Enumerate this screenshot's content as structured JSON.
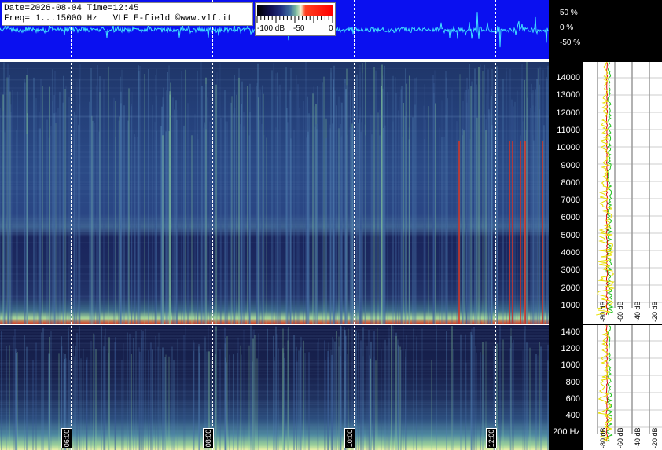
{
  "info": {
    "line1": "Date=2026-08-04 Time=12:45",
    "line2": "Freq= 1...15000 Hz   VLF E-field ©www.vlf.it"
  },
  "colorbar": {
    "labels": [
      "-100 dB",
      "-50",
      "0"
    ]
  },
  "wave_scale": {
    "labels": [
      "50 %",
      "0 %",
      "-50 %"
    ]
  },
  "freq_scale_hi": {
    "labels": [
      "14000",
      "13000",
      "12000",
      "11000",
      "10000",
      "9000",
      "8000",
      "7000",
      "6000",
      "5000",
      "4000",
      "3000",
      "2000",
      "1000"
    ]
  },
  "freq_scale_lo": {
    "labels": [
      "1400",
      "1200",
      "1000",
      "800",
      "600",
      "400",
      "200 Hz"
    ]
  },
  "time_axis": {
    "labels": [
      "06:00",
      "08:00",
      "10:00",
      "12:00"
    ]
  },
  "profile_hi": {
    "db_labels": [
      "-80 dB",
      "-60 dB",
      "-40 dB",
      "-20 dB"
    ]
  },
  "profile_lo": {
    "db_labels": [
      "-80 dB",
      "-60 dB",
      "-40 dB",
      "-20 dB"
    ]
  },
  "colors": {
    "wave_bg": "#0a10f0",
    "trace": "#40e0ff",
    "profile_yellow": "#e8e000",
    "profile_green": "#20c020",
    "profile_red": "#e00000"
  }
}
